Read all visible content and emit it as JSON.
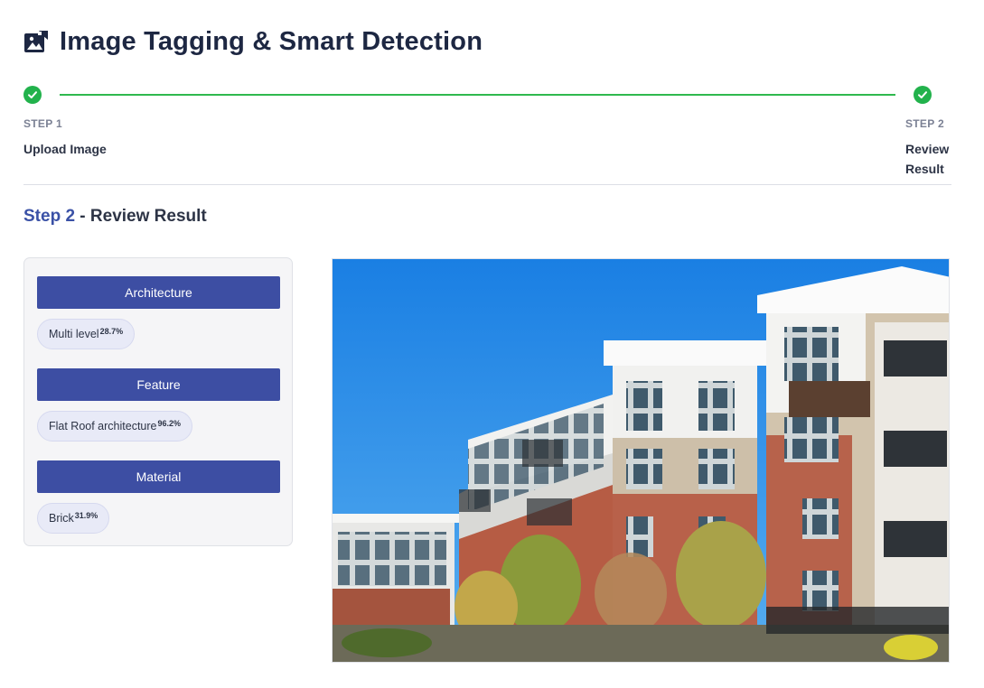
{
  "header": {
    "title": "Image Tagging & Smart Detection",
    "logo_icon": "image-tag-icon"
  },
  "stepper": {
    "steps": [
      {
        "number": "STEP 1",
        "name": "Upload Image",
        "status": "complete"
      },
      {
        "number": "STEP 2",
        "name": "Review Result",
        "status": "complete"
      }
    ],
    "complete_color": "#22b24c"
  },
  "section": {
    "step_label": "Step 2",
    "separator": " - ",
    "title": "Review Result"
  },
  "tags_panel": {
    "groups": [
      {
        "category": "Architecture",
        "tags": [
          {
            "label": "Multi level",
            "confidence": "28.7%"
          }
        ]
      },
      {
        "category": "Feature",
        "tags": [
          {
            "label": "Flat Roof architecture",
            "confidence": "96.2%"
          }
        ]
      },
      {
        "category": "Material",
        "tags": [
          {
            "label": "Brick",
            "confidence": "31.9%"
          }
        ]
      }
    ],
    "accent_color": "#3d4ea3"
  },
  "image": {
    "subject": "apartment-building-photo"
  }
}
